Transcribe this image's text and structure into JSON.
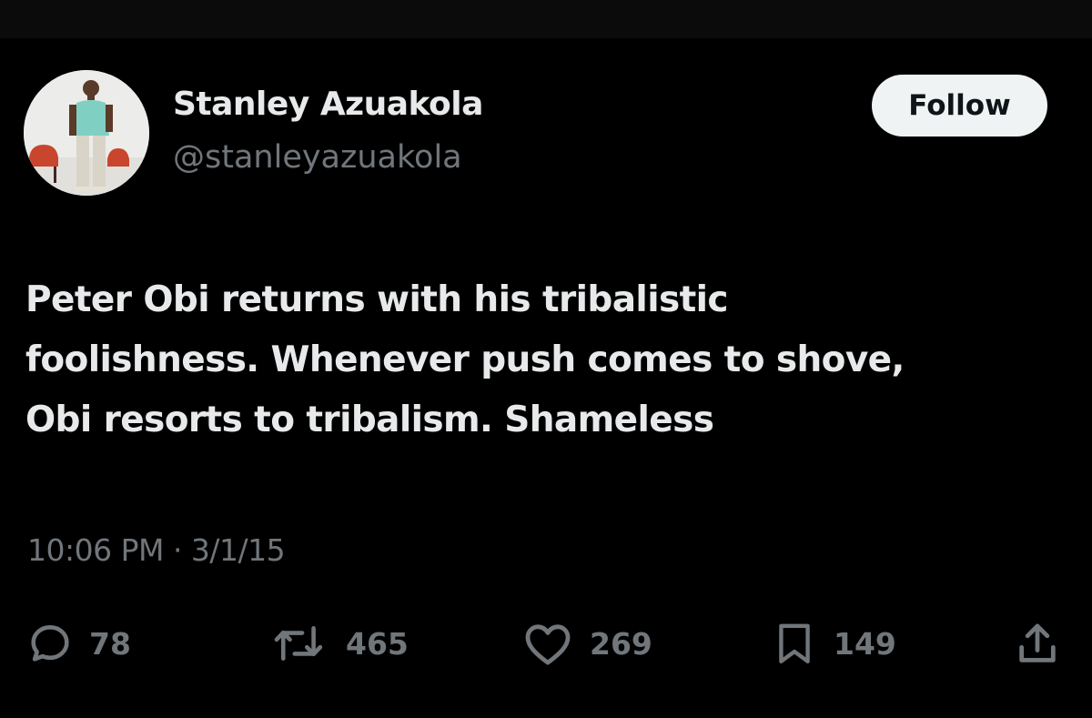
{
  "tweet": {
    "author": {
      "display_name": "Stanley Azuakola",
      "handle": "@stanleyazuakola"
    },
    "follow_label": "Follow",
    "text_lines": [
      "Peter Obi returns with his tribalistic",
      "foolishness. Whenever push comes to shove,",
      "Obi resorts to tribalism. Shameless"
    ],
    "timestamp": "10:06 PM · 3/1/15",
    "stats": {
      "replies": "78",
      "reposts": "465",
      "likes": "269",
      "bookmarks": "149"
    }
  },
  "icons": {
    "reply": "reply-icon",
    "repost": "repost-icon",
    "like": "heart-icon",
    "bookmark": "bookmark-icon",
    "share": "share-icon"
  },
  "colors": {
    "background": "#000000",
    "text_primary": "#e7e9ea",
    "text_secondary": "#71767b",
    "follow_button_bg": "#eff3f4",
    "follow_button_text": "#0f1419"
  }
}
